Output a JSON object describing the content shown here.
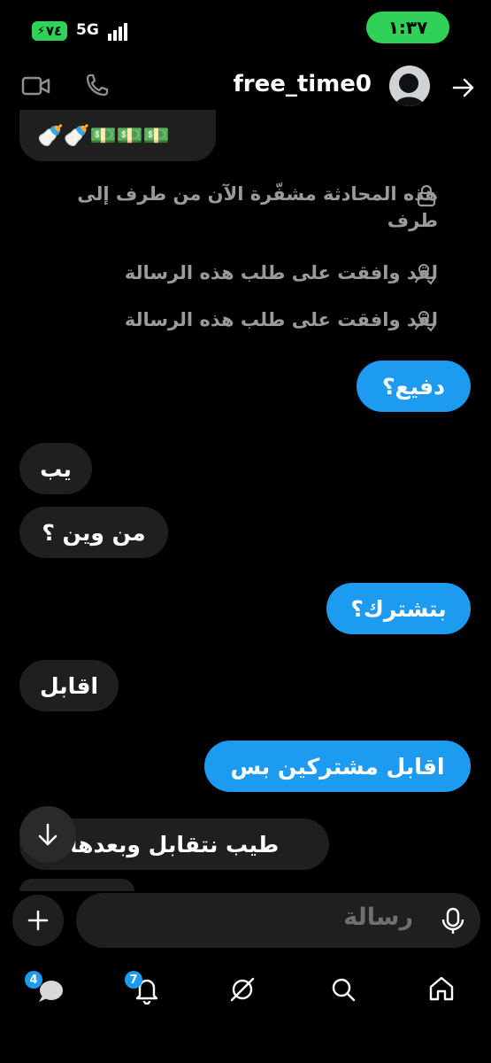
{
  "status_bar": {
    "battery": "٧٤",
    "network": "5G",
    "time": "١:٣٧"
  },
  "header": {
    "username": "free_time0"
  },
  "messages": {
    "emoji_row": "🍼🍼💵💵💵",
    "system_encrypted": "هذه المحادثة مشفّرة الآن من طرف إلى طرف",
    "system_accepted_1": "لقد وافقت على طلب هذه الرسالة",
    "system_accepted_2": "لقد وافقت على طلب هذه الرسالة",
    "m1": "دفيع؟",
    "m2": "يب",
    "m3": "من وين ؟",
    "m4": "بتشترك؟",
    "m5": "اقابل",
    "m6": "اقابل مشتركين بس",
    "m7": "طيب نتقابل وبعدها"
  },
  "composer": {
    "placeholder": "رسالة"
  },
  "nav": {
    "messages_badge": "4",
    "notifications_badge": "7"
  },
  "colors": {
    "accent": "#1d9bf0",
    "status_green": "#30d158",
    "bubble_incoming": "#1f1f1f"
  }
}
